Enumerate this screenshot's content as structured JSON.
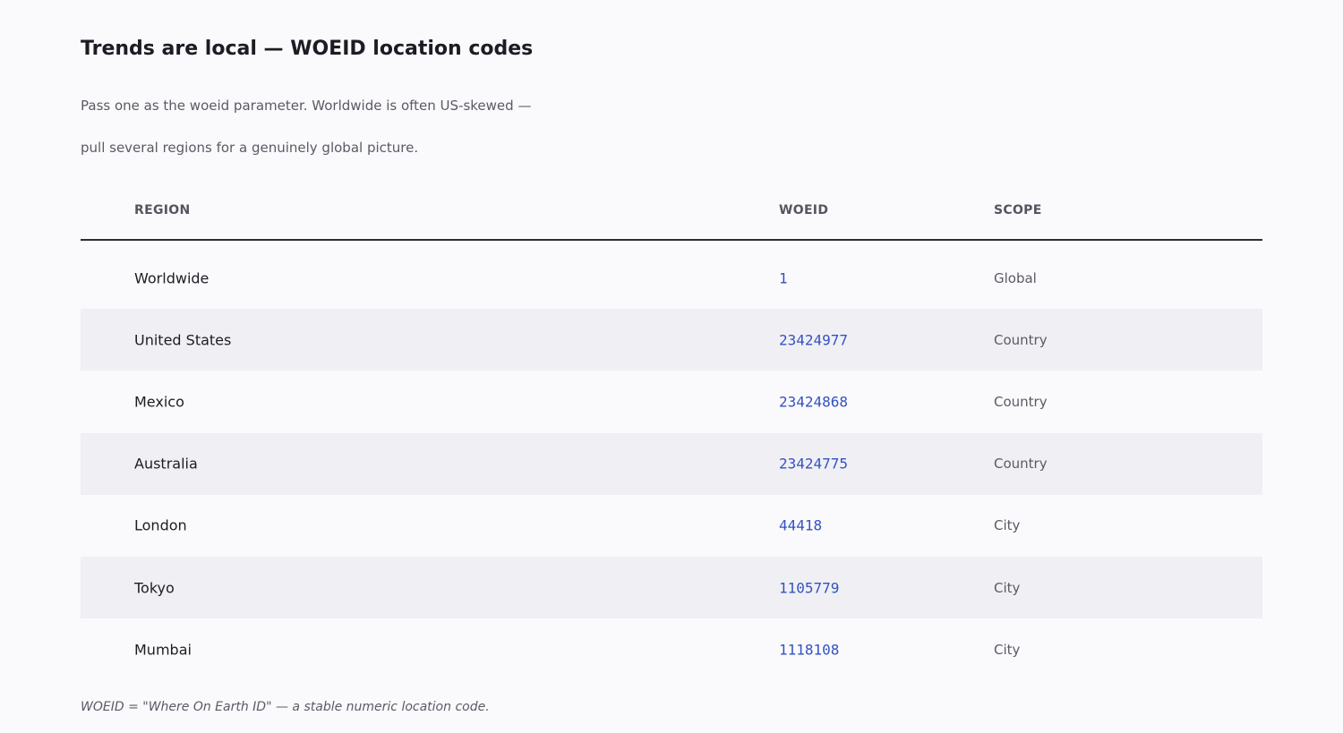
{
  "title": "Trends are local — WOEID location codes",
  "subtitle": {
    "line1": "Pass one as the woeid parameter. Worldwide is often US-skewed —",
    "line2": "pull several regions for a genuinely global picture."
  },
  "table": {
    "headers": {
      "region": "REGION",
      "woeid": "WOEID",
      "scope": "SCOPE"
    },
    "rows": [
      {
        "region": "Worldwide",
        "woeid": "1",
        "scope": "Global"
      },
      {
        "region": "United States",
        "woeid": "23424977",
        "scope": "Country"
      },
      {
        "region": "Mexico",
        "woeid": "23424868",
        "scope": "Country"
      },
      {
        "region": "Australia",
        "woeid": "23424775",
        "scope": "Country"
      },
      {
        "region": "London",
        "woeid": "44418",
        "scope": "City"
      },
      {
        "region": "Tokyo",
        "woeid": "1105779",
        "scope": "City"
      },
      {
        "region": "Mumbai",
        "woeid": "1118108",
        "scope": "City"
      }
    ]
  },
  "footnote": "WOEID = \"Where On Earth ID\" — a stable numeric location code.",
  "colors": {
    "background": "#fafafc",
    "stripe": "#f0f0f4",
    "woeid_text": "#3352c2",
    "header_rule": "#2c2c34"
  }
}
